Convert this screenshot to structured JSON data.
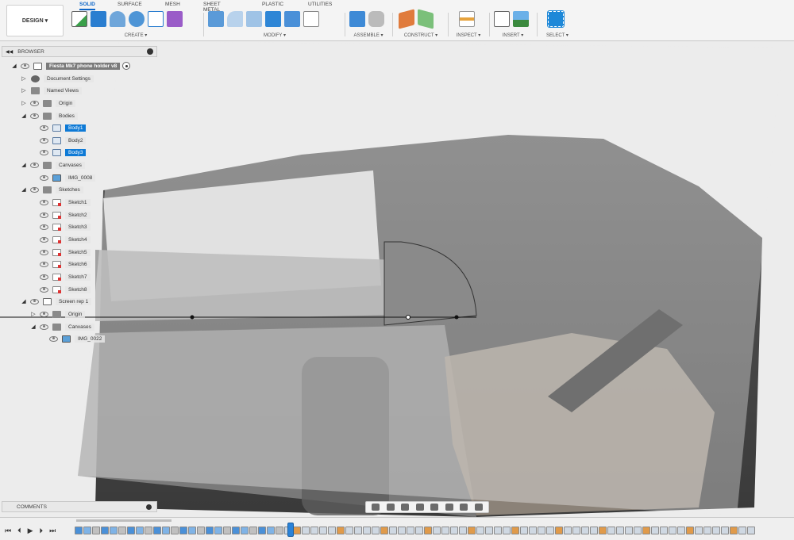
{
  "toolbar": {
    "design_label": "DESIGN ▾",
    "tabs": [
      "SOLID",
      "SURFACE",
      "MESH",
      "SHEET METAL",
      "PLASTIC",
      "UTILITIES"
    ],
    "groups": [
      "CREATE ▾",
      "MODIFY ▾",
      "ASSEMBLE ▾",
      "CONSTRUCT ▾",
      "INSPECT ▾",
      "INSERT ▾",
      "SELECT ▾"
    ],
    "accent": "#0a64c8"
  },
  "browser": {
    "title": "BROWSER",
    "root": "Fiesta Mk7 phone holder v8",
    "items": [
      {
        "label": "Document Settings",
        "icon": "gear-icon"
      },
      {
        "label": "Named Views",
        "icon": "folder-icon"
      },
      {
        "label": "Origin",
        "icon": "folder-icon"
      },
      {
        "label": "Bodies",
        "icon": "folder-icon"
      },
      {
        "label": "Body1",
        "icon": "body-icon"
      },
      {
        "label": "Body2",
        "icon": "body-icon"
      },
      {
        "label": "Body3",
        "icon": "body-icon"
      },
      {
        "label": "Canvases",
        "icon": "folder-icon"
      },
      {
        "label": "IMG_0008",
        "icon": "canvas-image-icon"
      },
      {
        "label": "Sketches",
        "icon": "folder-icon"
      },
      {
        "label": "Sketch1",
        "icon": "sketch-icon"
      },
      {
        "label": "Sketch2",
        "icon": "sketch-icon"
      },
      {
        "label": "Sketch3",
        "icon": "sketch-icon"
      },
      {
        "label": "Sketch4",
        "icon": "sketch-icon"
      },
      {
        "label": "Sketch5",
        "icon": "sketch-icon"
      },
      {
        "label": "Sketch6",
        "icon": "sketch-icon"
      },
      {
        "label": "Sketch7",
        "icon": "sketch-icon"
      },
      {
        "label": "Sketch8",
        "icon": "sketch-icon"
      },
      {
        "label": "Screen rep 1",
        "icon": "component-icon"
      },
      {
        "label": "Origin",
        "icon": "folder-icon"
      },
      {
        "label": "Canvases",
        "icon": "folder-icon"
      },
      {
        "label": "IMG_0022",
        "icon": "canvas-image-icon"
      }
    ]
  },
  "comments": {
    "title": "COMMENTS"
  },
  "timeline": {
    "controls": [
      "⏮",
      "⏴",
      "▶",
      "⏵",
      "⏭"
    ]
  }
}
